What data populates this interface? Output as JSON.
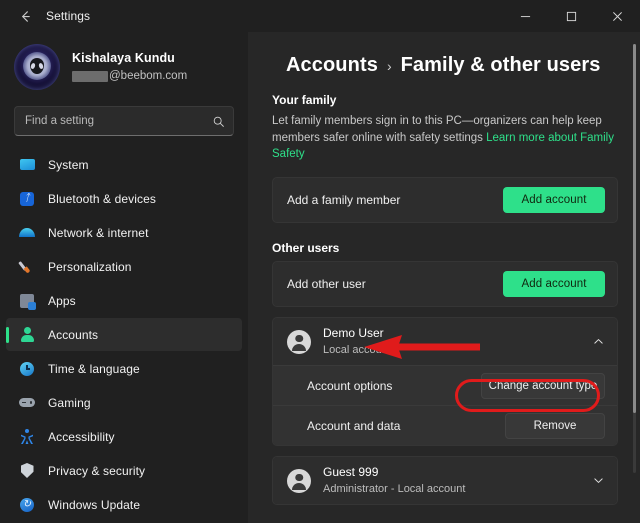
{
  "window": {
    "title": "Settings",
    "back_icon": "back-arrow-icon",
    "controls": {
      "minimize": "minimize-icon",
      "maximize": "maximize-icon",
      "close": "close-icon"
    }
  },
  "profile": {
    "avatar_icon": "alien-avatar-image",
    "name": "Kishalaya Kundu",
    "email_redacted": true,
    "email_domain": "@beebom.com"
  },
  "search": {
    "placeholder": "Find a setting",
    "value": "",
    "icon": "search-icon"
  },
  "sidebar": {
    "items": [
      {
        "label": "System",
        "icon": "system-icon",
        "active": false
      },
      {
        "label": "Bluetooth & devices",
        "icon": "bluetooth-icon",
        "active": false
      },
      {
        "label": "Network & internet",
        "icon": "wifi-icon",
        "active": false
      },
      {
        "label": "Personalization",
        "icon": "paintbrush-icon",
        "active": false
      },
      {
        "label": "Apps",
        "icon": "apps-icon",
        "active": false
      },
      {
        "label": "Accounts",
        "icon": "account-icon",
        "active": true
      },
      {
        "label": "Time & language",
        "icon": "clock-icon",
        "active": false
      },
      {
        "label": "Gaming",
        "icon": "gamepad-icon",
        "active": false
      },
      {
        "label": "Accessibility",
        "icon": "accessibility-icon",
        "active": false
      },
      {
        "label": "Privacy & security",
        "icon": "shield-icon",
        "active": false
      },
      {
        "label": "Windows Update",
        "icon": "update-icon",
        "active": false
      }
    ]
  },
  "breadcrumb": {
    "root": "Accounts",
    "separator": "›",
    "leaf": "Family & other users"
  },
  "family_section": {
    "title": "Your family",
    "description": "Let family members sign in to this PC—organizers can help keep members safer online with safety settings ",
    "link": "Learn more about Family Safety",
    "card": {
      "label": "Add a family member",
      "button": "Add account"
    }
  },
  "other_users_section": {
    "title": "Other users",
    "add_card": {
      "label": "Add other user",
      "button": "Add account"
    },
    "users": [
      {
        "name": "Demo User",
        "subtitle": "Local account",
        "expanded": true,
        "chevron": "chevron-up-icon",
        "avatar_icon": "user-avatar-icon",
        "options": [
          {
            "label": "Account options",
            "button": "Change account type",
            "highlighted": true
          },
          {
            "label": "Account and data",
            "button": "Remove",
            "highlighted": false
          }
        ]
      },
      {
        "name": "Guest 999",
        "subtitle": "Administrator - Local account",
        "expanded": false,
        "chevron": "chevron-down-icon",
        "avatar_icon": "user-avatar-icon",
        "options": []
      }
    ]
  },
  "annotations": {
    "arrow": {
      "name": "red-arrow-pointing-to-demo-user",
      "color": "#e01b1b"
    },
    "ring": {
      "name": "red-highlight-around-change-account-type",
      "color": "#e01b1b"
    }
  },
  "colors": {
    "accent_green": "#2ee08a",
    "annotation_red": "#e01b1b",
    "window_bg": "#202020",
    "content_bg": "#272727",
    "card_bg": "#2d2d2d"
  }
}
